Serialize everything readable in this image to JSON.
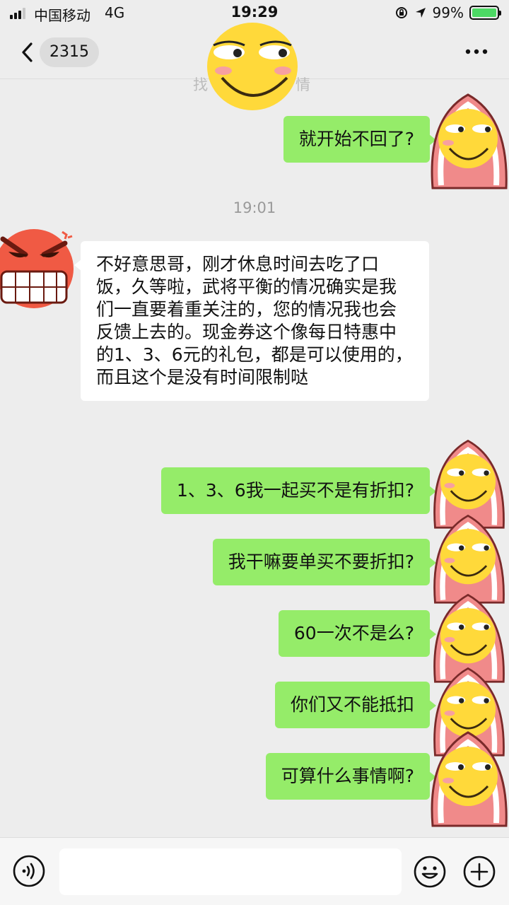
{
  "status_bar": {
    "carrier": "中国移动",
    "network": "4G",
    "time": "19:29",
    "battery_text": "99%",
    "battery_level": 0.99,
    "icons": [
      "signal-icon",
      "rotation-lock-icon",
      "location-icon",
      "battery-icon"
    ]
  },
  "header": {
    "unread_count": "2315",
    "more_icon": "more-dots-icon",
    "back_icon": "chevron-left-icon"
  },
  "chat": {
    "faded_left": "找",
    "faded_right": "情",
    "timestamp": "19:01",
    "messages": [
      {
        "dir": "out",
        "text": "就开始不回了?"
      },
      {
        "dir": "in",
        "text": "不好意思哥，刚才休息时间去吃了口饭，久等啦，武将平衡的情况确实是我们一直要着重关注的，您的情况我也会反馈上去的。现金券这个像每日特惠中的1、3、6元的礼包，都是可以使用的，而且这个是没有时间限制哒"
      },
      {
        "dir": "out",
        "text": "1、3、6我一起买不是有折扣?"
      },
      {
        "dir": "out",
        "text": "我干嘛要单买不要折扣?"
      },
      {
        "dir": "out",
        "text": "60一次不是么?"
      },
      {
        "dir": "out",
        "text": "你们又不能抵扣"
      },
      {
        "dir": "out",
        "text": "可算什么事情啊?"
      }
    ]
  },
  "input_bar": {
    "placeholder": "",
    "icons": [
      "voice-icon",
      "emoji-icon",
      "plus-icon"
    ]
  },
  "colors": {
    "background": "#ededed",
    "outgoing_bubble": "#95ec69",
    "incoming_bubble": "#ffffff",
    "sticker_yellow": "#ffd93a",
    "sticker_red": "#f05a44",
    "hood_pink": "#f08a8a"
  }
}
